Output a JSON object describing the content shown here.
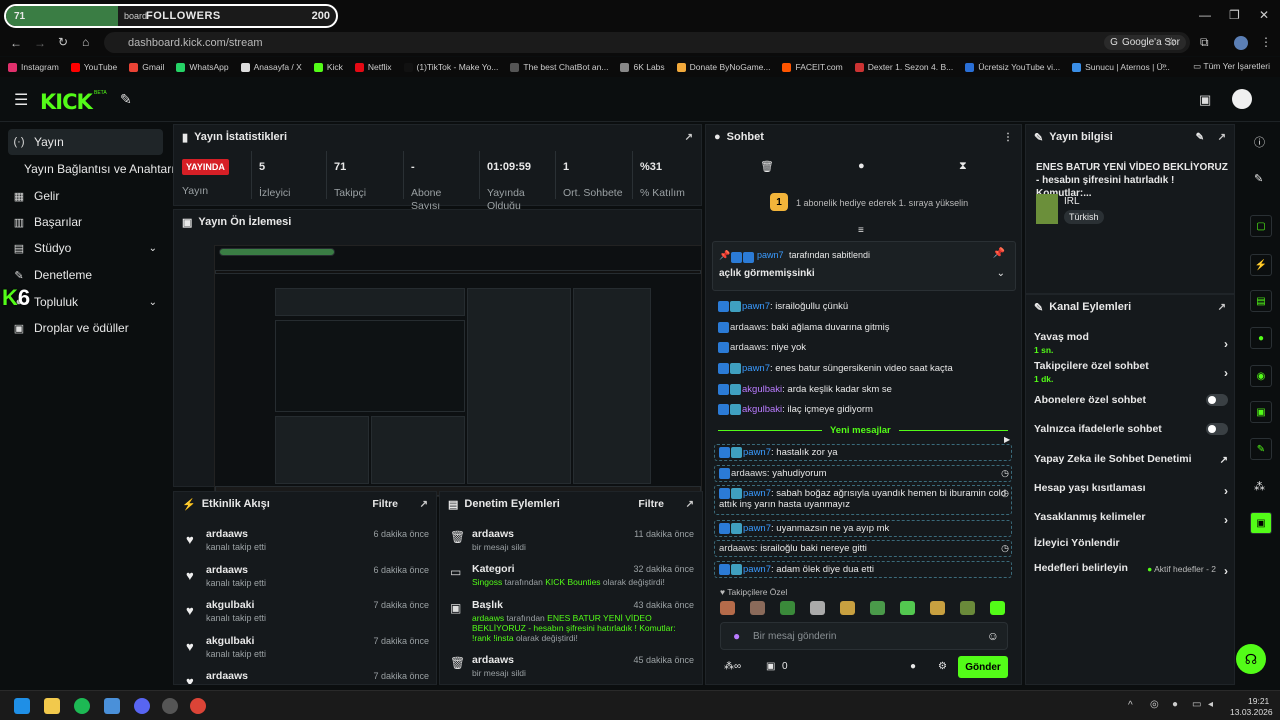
{
  "overlay": {
    "current": "71",
    "label": "FOLLOWERS",
    "target": "200",
    "tab_fragment": "board"
  },
  "browser": {
    "url": "dashboard.kick.com/stream",
    "google_ask": "Google'a Sor",
    "bookmarks": [
      "Instagram",
      "YouTube",
      "Gmail",
      "WhatsApp",
      "Anasayfa / X",
      "Kick",
      "Netflix",
      "(1)TikTok - Make Yo...",
      "The best ChatBot an...",
      "6K Labs",
      "Donate ByNoGame...",
      "FACEIT.com",
      "Dexter 1. Sezon 4. B...",
      "Ücretsiz YouTube vi...",
      "Sunucu | Aternos | Ü..."
    ],
    "all_bookmarks": "Tüm Yer İşaretleri"
  },
  "header": {
    "logo": "KICK",
    "beta": "BETA"
  },
  "sidebar": {
    "items": [
      {
        "label": "Yayın",
        "icon": "stream-icon"
      },
      {
        "label": "Yayın Bağlantısı ve Anahtarı",
        "icon": ""
      },
      {
        "label": "Gelir",
        "icon": "revenue-icon"
      },
      {
        "label": "Başarılar",
        "icon": "trophy-icon"
      },
      {
        "label": "Stüdyo",
        "icon": "studio-icon"
      },
      {
        "label": "Denetleme",
        "icon": "wrench-icon"
      },
      {
        "label": "Topluluk",
        "icon": "community-icon"
      },
      {
        "label": "Droplar ve ödüller",
        "icon": "gift-icon"
      }
    ],
    "overlay_count": "6"
  },
  "stats": {
    "title": "Yayın İstatistikleri",
    "live": "YAYINDA",
    "live_label": "Yayın",
    "items": [
      {
        "value": "5",
        "label": "İzleyici"
      },
      {
        "value": "71",
        "label": "Takipçi"
      },
      {
        "value": "-",
        "label": "Abone Sayısı"
      },
      {
        "value": "01:09:59",
        "label": "Yayında Olduğu"
      },
      {
        "value": "1",
        "label": "Ort. Sohbete"
      },
      {
        "value": "%31",
        "label": "% Katılım"
      }
    ]
  },
  "preview": {
    "title": "Yayın Ön İzlemesi"
  },
  "activity": {
    "title": "Etkinlik Akışı",
    "filter": "Filtre",
    "items": [
      {
        "name": "ardaaws",
        "sub": "kanalı takip etti",
        "time": "6 dakika önce"
      },
      {
        "name": "ardaaws",
        "sub": "kanalı takip etti",
        "time": "6 dakika önce"
      },
      {
        "name": "akgulbaki",
        "sub": "kanalı takip etti",
        "time": "7 dakika önce"
      },
      {
        "name": "akgulbaki",
        "sub": "kanalı takip etti",
        "time": "7 dakika önce"
      },
      {
        "name": "ardaaws",
        "sub": "",
        "time": "7 dakika önce"
      }
    ]
  },
  "moderation": {
    "title": "Denetim Eylemleri",
    "filter": "Filtre",
    "items": [
      {
        "name": "ardaaws",
        "sub": "bir mesajı sildi",
        "time": "11 dakika önce",
        "icon": "trash-icon"
      },
      {
        "name": "Kategori",
        "sub_user": "Singoss",
        "sub_mid": " tarafından ",
        "sub_val": "KICK Bounties",
        "sub_end": " olarak değiştirdi!",
        "time": "32 dakika önce",
        "icon": "category-icon"
      },
      {
        "name": "Başlık",
        "sub_user": "ardaaws",
        "sub_mid": " tarafından ",
        "sub_val": "ENES BATUR YENİ VİDEO BEKLİYORUZ - hesabın şifresini hatırladık ! Komutlar: !rank !insta",
        "sub_end": " olarak değiştirdi!",
        "time": "43 dakika önce",
        "icon": "title-icon"
      },
      {
        "name": "ardaaws",
        "sub": "bir mesajı sildi",
        "time": "45 dakika önce",
        "icon": "trash-icon"
      }
    ]
  },
  "chat": {
    "title": "Sohbet",
    "gift_count": "1",
    "gift_text": "1 abonelik hediye ederek 1. sıraya yükselin",
    "pinned_by": "pawn7",
    "pinned_suffix": " tarafından sabitlendi",
    "pinned_msg": "açlık görmemişsinki",
    "new_messages": "Yeni mesajlar",
    "messages": [
      {
        "user": "pawn7",
        "text": "israiloğullu çünkü",
        "color": "#3a9bff",
        "badges": 2
      },
      {
        "user": "ardaaws",
        "text": "baki ağlama duvarına gitmiş",
        "color": "#dddddd",
        "badges": 1
      },
      {
        "user": "ardaaws",
        "text": "niye yok",
        "color": "#dddddd",
        "badges": 1
      },
      {
        "user": "pawn7",
        "text": "enes batur süngersikenin video saat kaçta",
        "color": "#3a9bff",
        "badges": 2
      },
      {
        "user": "akgulbaki",
        "text": "arda keşlik kadar skm se",
        "color": "#b97bff",
        "badges": 2
      },
      {
        "user": "akgulbaki",
        "text": "ilaç içmeye gidiyorm",
        "color": "#b97bff",
        "badges": 2
      },
      {
        "user": "pawn7",
        "text": "hastalık zor ya",
        "color": "#3a9bff",
        "badges": 2
      },
      {
        "user": "ardaaws",
        "text": "yahudiyorum",
        "color": "#dddddd",
        "badges": 1
      },
      {
        "user": "pawn7",
        "text": "sabah boğaz ağrısıyla uyandık hemen bi iburamin cold",
        "text2": "attık inş yarın hasta uyanmayız",
        "color": "#3a9bff",
        "badges": 2
      },
      {
        "user": "pawn7",
        "text": "uyanmazsın ne ya ayıp mk",
        "color": "#3a9bff",
        "badges": 2
      },
      {
        "user": "ardaaws",
        "text": "israiloğlu baki nereye gitti",
        "color": "#dddddd",
        "badges": 0
      },
      {
        "user": "pawn7",
        "text": "adam ölek diye dua etti",
        "color": "#3a9bff",
        "badges": 2
      }
    ],
    "followers_only": "Takipçilere Özel",
    "input_placeholder": "Bir mesaj gönderin",
    "points": "0",
    "send": "Gönder"
  },
  "stream_info": {
    "title": "Yayın bilgisi",
    "stream_title": "ENES BATUR YENİ VİDEO BEKLİYORUZ - hesabın şifresini hatırladık ! Komutlar:...",
    "category": "IRL",
    "language": "Türkish"
  },
  "channel_actions": {
    "title": "Kanal Eylemleri",
    "rows": [
      {
        "label": "Yavaş mod",
        "sub": "1 sn.",
        "type": "arrow"
      },
      {
        "label": "Takipçilere özel sohbet",
        "sub": "1 dk.",
        "type": "arrow"
      },
      {
        "label": "Abonelere özel sohbet",
        "sub": "",
        "type": "toggle"
      },
      {
        "label": "Yalnızca ifadelerle sohbet",
        "sub": "",
        "type": "toggle"
      },
      {
        "label": "Yapay Zeka ile Sohbet Denetimi",
        "sub": "",
        "type": "external"
      },
      {
        "label": "Hesap yaşı kısıtlaması",
        "sub": "",
        "type": "arrow"
      },
      {
        "label": "Yasaklanmış kelimeler",
        "sub": "",
        "type": "arrow"
      },
      {
        "label": "İzleyici Yönlendir",
        "sub": "",
        "type": "none"
      },
      {
        "label": "Hedefleri belirleyin",
        "sub": "",
        "type": "arrow",
        "extra": "Aktif hedefler - 2"
      }
    ]
  },
  "taskbar": {
    "time": "19:21",
    "date": "13.03.2026"
  },
  "colors": {
    "brand": "#53fc18",
    "live": "#d61f26",
    "panel": "#15191c"
  }
}
